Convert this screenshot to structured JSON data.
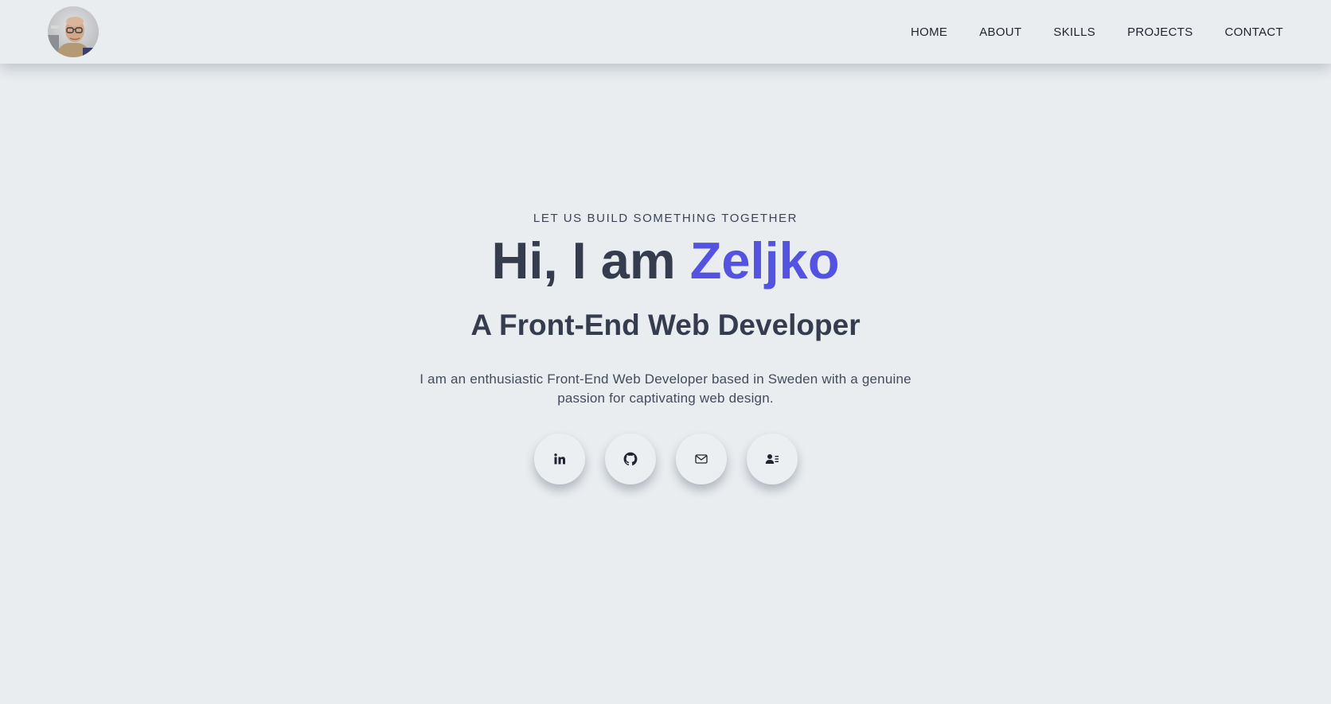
{
  "nav": {
    "avatar_alt": "Profile photo",
    "links": [
      "HOME",
      "ABOUT",
      "SKILLS",
      "PROJECTS",
      "CONTACT"
    ]
  },
  "hero": {
    "tagline": "LET US BUILD SOMETHING TOGETHER",
    "greeting": "Hi, I am ",
    "name": "Zeljko",
    "subtitle": "A Front-End Web Developer",
    "intro": "I am an enthusiastic Front-End Web Developer based in Sweden with a genuine passion for captivating web design."
  },
  "socials": [
    {
      "icon": "linkedin-icon"
    },
    {
      "icon": "github-icon"
    },
    {
      "icon": "mail-icon"
    },
    {
      "icon": "contact-card-icon"
    }
  ],
  "colors": {
    "background": "#e9edf0",
    "text": "#343c4e",
    "accent": "#5452e0"
  }
}
